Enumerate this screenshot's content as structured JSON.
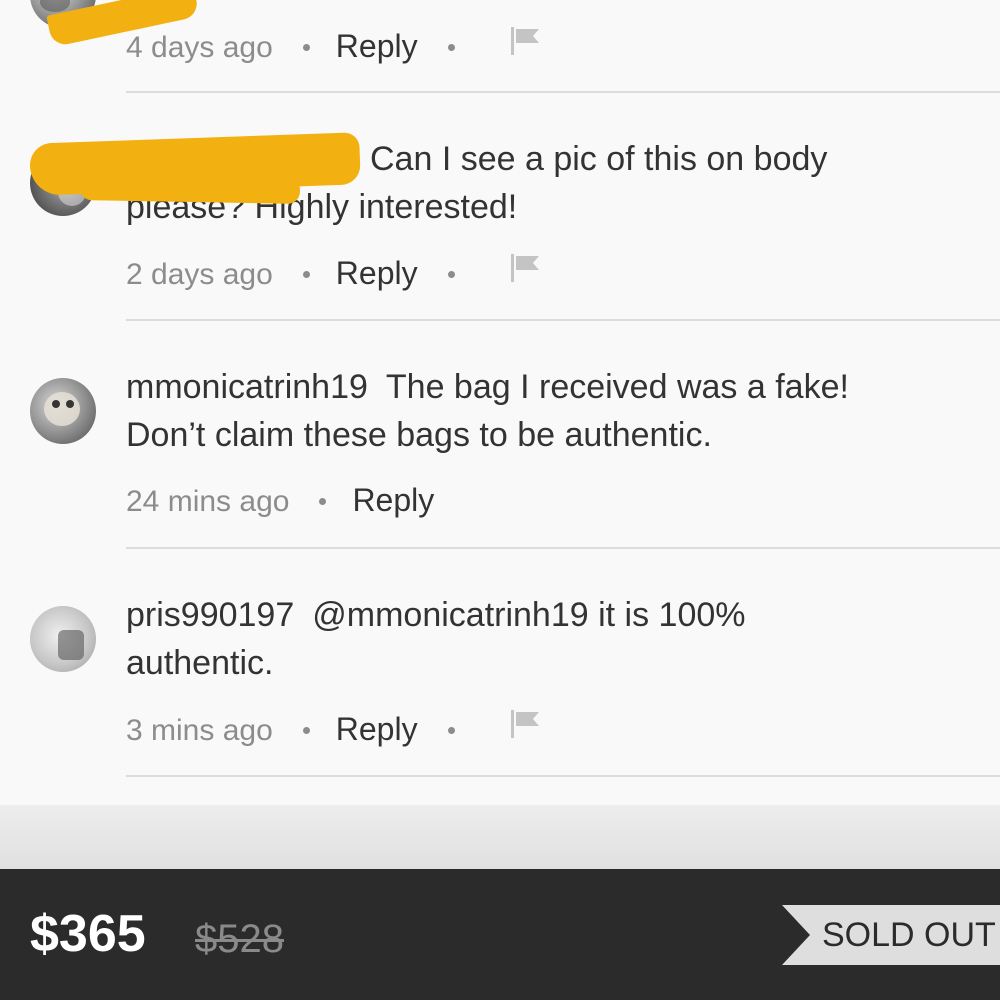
{
  "comments": [
    {
      "username": "",
      "text": "",
      "time": "4 days ago",
      "reply_label": "Reply",
      "has_flag": true,
      "redacted": true,
      "avatar_icon": "avatar-photo-icon"
    },
    {
      "username": "",
      "text_line1": "Can I see a pic of this on body",
      "text_line2": "please? Highly interested!",
      "time": "2 days ago",
      "reply_label": "Reply",
      "has_flag": true,
      "redacted": true,
      "avatar_icon": "avatar-photo-icon"
    },
    {
      "username": "mmonicatrinh19",
      "text_line1": "The bag I received was a fake!",
      "text_line2": "Don’t claim these bags to be authentic.",
      "time": "24 mins ago",
      "reply_label": "Reply",
      "has_flag": false,
      "avatar_icon": "avatar-dog-photo-icon"
    },
    {
      "username": "pris990197",
      "text_line1": "@mmonicatrinh19 it is 100%",
      "text_line2": "authentic.",
      "time": "3 mins ago",
      "reply_label": "Reply",
      "has_flag": true,
      "avatar_icon": "avatar-bag-photo-icon"
    }
  ],
  "footer": {
    "price": "$365",
    "original_price": "$528",
    "status_label": "SOLD OUT"
  },
  "colors": {
    "redaction": "#f2b111",
    "footer_bg": "#2b2b2b",
    "text": "#333333",
    "meta": "#8c8c8c"
  }
}
